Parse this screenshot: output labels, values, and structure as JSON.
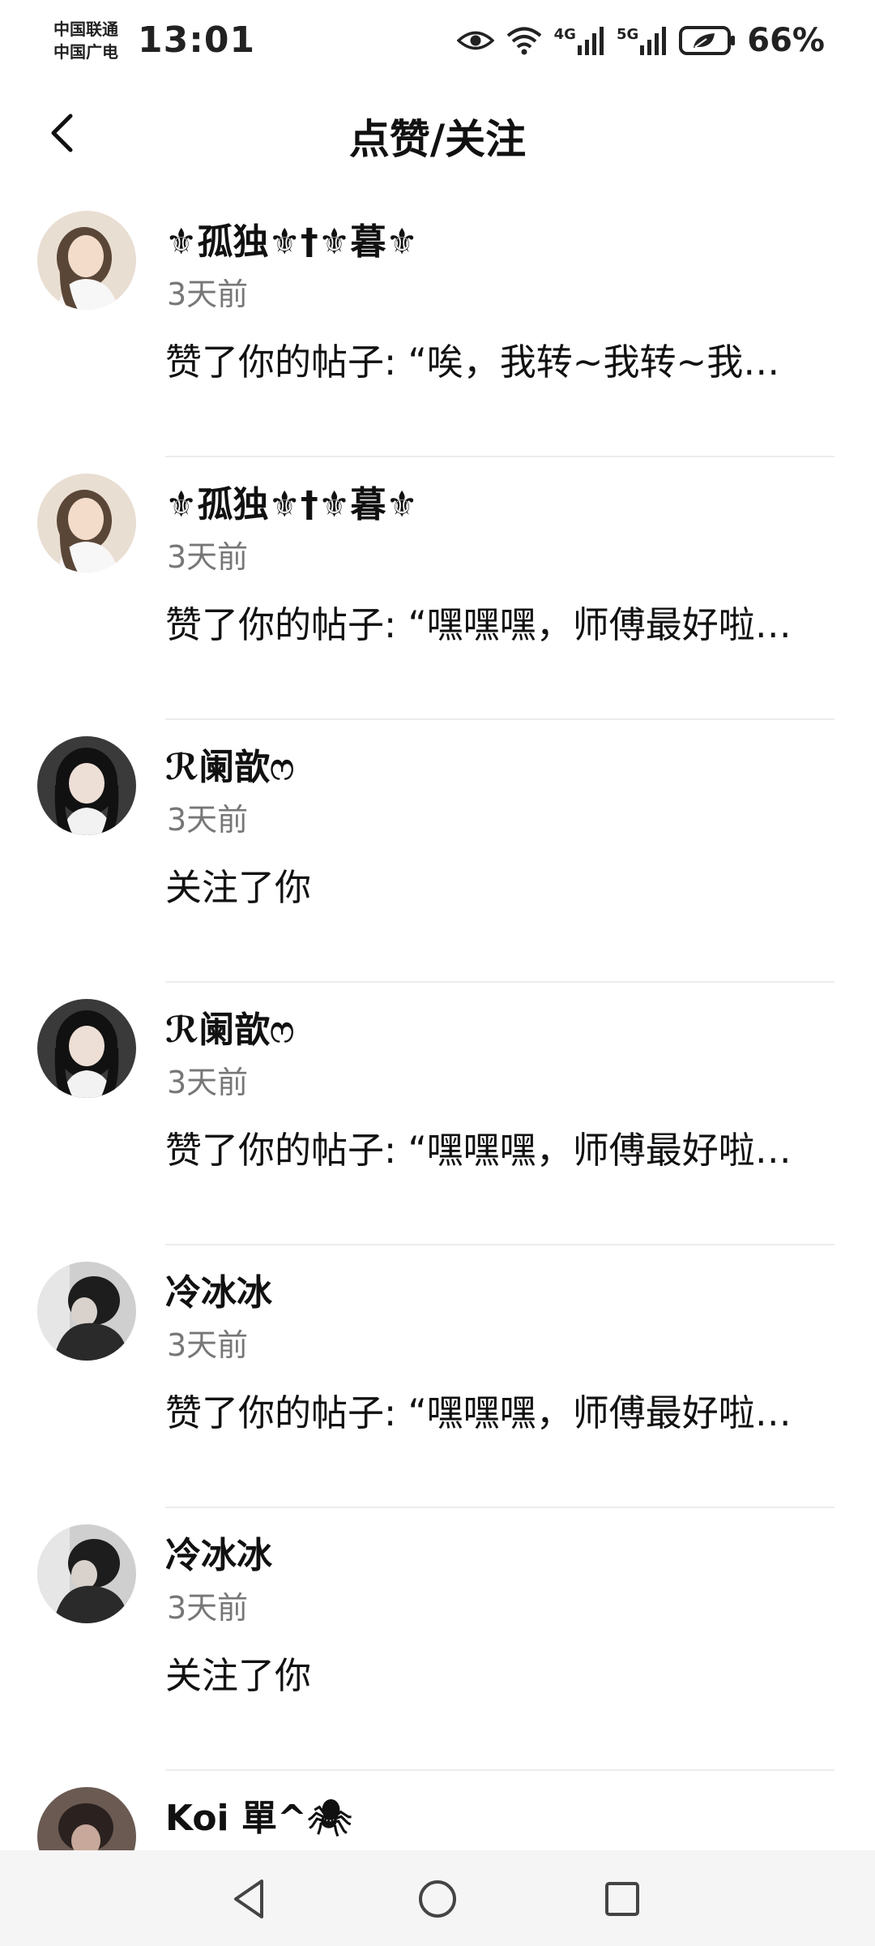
{
  "status_bar": {
    "carrier_1": "中国联通",
    "carrier_2": "中国广电",
    "time": "13:01",
    "network_1": "4G",
    "network_2": "5G",
    "battery_percent": "66%",
    "icons": [
      "eye-icon",
      "wifi-icon",
      "signal-icon",
      "battery-icon"
    ]
  },
  "header": {
    "title": "点赞/关注",
    "back_icon": "chevron-left-icon"
  },
  "notifications": [
    {
      "name": "⚜孤独⚜†⚜暮⚜",
      "time": "3天前",
      "action": "赞了你的帖子: “唉，我转~我转~我…",
      "avatar": {
        "bg": "#e9ded2",
        "hair": "#5a4637",
        "skin": "#f3dcc9"
      }
    },
    {
      "name": "⚜孤独⚜†⚜暮⚜",
      "time": "3天前",
      "action": "赞了你的帖子: “嘿嘿嘿，师傅最好啦…",
      "avatar": {
        "bg": "#e9ded2",
        "hair": "#5a4637",
        "skin": "#f3dcc9"
      }
    },
    {
      "name": "ℛ阑歆ෆ",
      "time": "3天前",
      "action": "关注了你",
      "avatar": {
        "bg": "#3a3a3a",
        "hair": "#111111",
        "skin": "#eedfd6"
      }
    },
    {
      "name": "ℛ阑歆ෆ",
      "time": "3天前",
      "action": "赞了你的帖子: “嘿嘿嘿，师傅最好啦…",
      "avatar": {
        "bg": "#3a3a3a",
        "hair": "#111111",
        "skin": "#eedfd6"
      }
    },
    {
      "name": "冷冰冰",
      "time": "3天前",
      "action": "赞了你的帖子: “嘿嘿嘿，师傅最好啦…",
      "avatar": {
        "bg": "#cfcfcf",
        "hair": "#1d1d1d",
        "skin": "#d9d2cc"
      }
    },
    {
      "name": "冷冰冰",
      "time": "3天前",
      "action": "关注了你",
      "avatar": {
        "bg": "#cfcfcf",
        "hair": "#1d1d1d",
        "skin": "#d9d2cc"
      }
    },
    {
      "name": "Koi 單^🕷",
      "time": "",
      "action": "",
      "avatar": {
        "bg": "#6b5a52",
        "hair": "#2b2220",
        "skin": "#c7a89a"
      }
    }
  ],
  "nav_bar": {
    "icons": [
      "back-triangle-icon",
      "home-circle-icon",
      "recents-square-icon"
    ]
  },
  "colors": {
    "text_primary": "#111111",
    "text_secondary": "#777777",
    "divider": "#ececec",
    "nav_bg": "#f5f5f5"
  }
}
